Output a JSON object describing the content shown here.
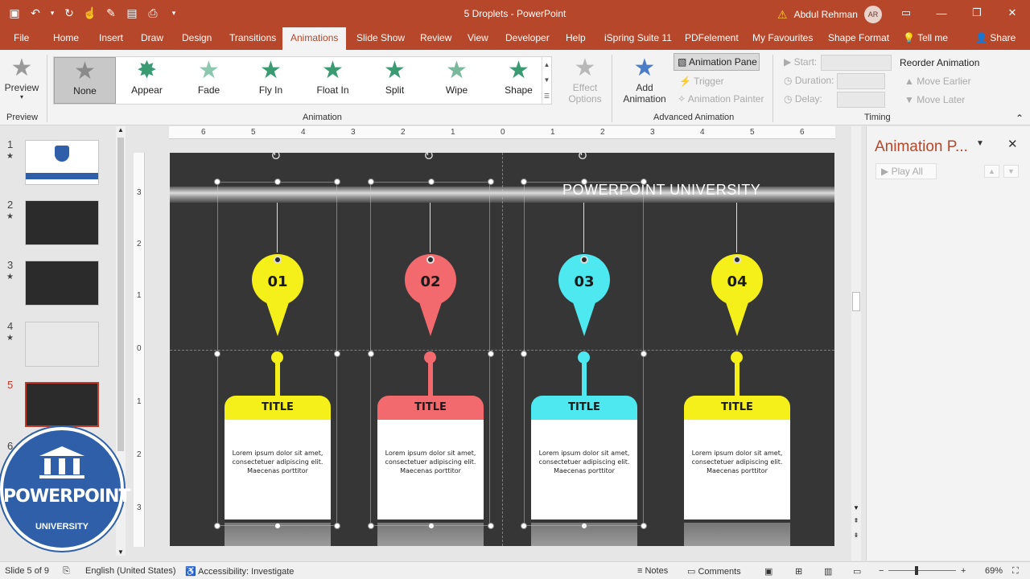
{
  "window": {
    "doc_title": "5 Droplets  -  PowerPoint",
    "user_name": "Abdul Rehman",
    "user_initials": "AR"
  },
  "tabs": [
    "File",
    "Home",
    "Insert",
    "Draw",
    "Design",
    "Transitions",
    "Animations",
    "Slide Show",
    "Review",
    "View",
    "Developer",
    "Help",
    "iSpring Suite 11",
    "PDFelement",
    "My Favourites",
    "Shape Format",
    "Tell me",
    "Share"
  ],
  "active_tab": "Animations",
  "ribbon": {
    "preview_label": "Preview",
    "preview_group": "Preview",
    "gallery": [
      "None",
      "Appear",
      "Fade",
      "Fly In",
      "Float In",
      "Split",
      "Wipe",
      "Shape"
    ],
    "selected": "None",
    "effect_options_1": "Effect",
    "effect_options_2": "Options",
    "animation_group": "Animation",
    "add_animation_1": "Add",
    "add_animation_2": "Animation",
    "animation_pane": "Animation Pane",
    "trigger": "Trigger",
    "animation_painter": "Animation Painter",
    "advanced_group": "Advanced Animation",
    "start": "Start:",
    "duration": "Duration:",
    "delay": "Delay:",
    "reorder": "Reorder Animation",
    "move_earlier": "Move Earlier",
    "move_later": "Move Later",
    "timing_group": "Timing"
  },
  "thumbnails": [
    {
      "num": "1",
      "star": "★"
    },
    {
      "num": "2",
      "star": "★"
    },
    {
      "num": "3",
      "star": "★"
    },
    {
      "num": "4",
      "star": "★"
    },
    {
      "num": "5",
      "star": ""
    },
    {
      "num": "6",
      "star": ""
    }
  ],
  "active_slide": "5",
  "ruler_h": [
    "6",
    "5",
    "4",
    "3",
    "2",
    "1",
    "0",
    "1",
    "2",
    "3",
    "4",
    "5",
    "6"
  ],
  "ruler_v": [
    "3",
    "2",
    "1",
    "0",
    "1",
    "2",
    "3"
  ],
  "slide": {
    "brand": "POWERPOINT UNIVERSITY",
    "cards": [
      {
        "num": "01",
        "title": "TITLE",
        "color": "#f5f01a",
        "text": "Lorem ipsum dolor sit amet, consectetuer adipiscing elit. Maecenas porttitor"
      },
      {
        "num": "02",
        "title": "TITLE",
        "color": "#f26a6e",
        "text": "Lorem ipsum dolor sit amet, consectetuer adipiscing elit. Maecenas porttitor"
      },
      {
        "num": "03",
        "title": "TITLE",
        "color": "#4de8f0",
        "text": "Lorem ipsum dolor sit amet, consectetuer adipiscing elit. Maecenas porttitor"
      },
      {
        "num": "04",
        "title": "TITLE",
        "color": "#f5f01a",
        "text": "Lorem ipsum dolor sit amet, consectetuer adipiscing elit. Maecenas porttitor"
      }
    ]
  },
  "pane": {
    "title": "Animation P...",
    "play_all": "Play All"
  },
  "status": {
    "slide_of": "Slide 5 of 9",
    "language": "English (United States)",
    "accessibility": "Accessibility: Investigate",
    "notes": "Notes",
    "comments": "Comments",
    "zoom": "69%"
  },
  "logo": {
    "word": "POWERPOINT",
    "sub": "UNIVERSITY"
  }
}
